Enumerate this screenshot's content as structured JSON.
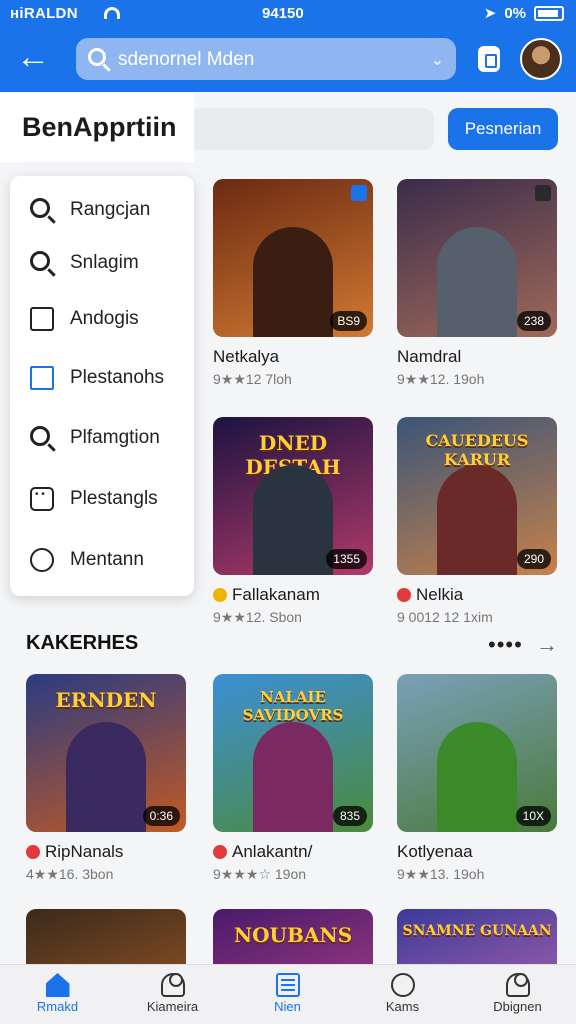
{
  "status": {
    "carrier": "ніRALDN",
    "time": "94150",
    "battery": "0%"
  },
  "header": {
    "search_text": "sdenornel Mden"
  },
  "page": {
    "title": "BenApprtiin",
    "primary_button": "Pesnerian"
  },
  "menu": {
    "items": [
      {
        "label": "Rangcjan",
        "icon": "search-icon"
      },
      {
        "label": "Snlagim",
        "icon": "search-icon"
      },
      {
        "label": "Andogis",
        "icon": "checkbox-icon"
      },
      {
        "label": "Plestanohs",
        "icon": "checkbox-outline-icon"
      },
      {
        "label": "Plfamgtion",
        "icon": "search-icon"
      },
      {
        "label": "Plestangls",
        "icon": "grid-icon"
      },
      {
        "label": "Mentann",
        "icon": "clock-icon"
      }
    ]
  },
  "featured": [
    {
      "name": "Netkalya",
      "meta": "9★★12 7loh",
      "badge": "BS9",
      "colors": [
        "#6b2a12",
        "#d27a32"
      ],
      "figure": "#3a1e14"
    },
    {
      "name": "Namdral",
      "meta": "9★★12. 19oh",
      "badge": "238",
      "colors": [
        "#3b2c4a",
        "#a06a5a"
      ],
      "figure": "#55606c"
    },
    {
      "name": "Fallakanam",
      "meta": "9★★12. Sbon",
      "badge": "1355",
      "logo": "DNED DESTAH",
      "colors": [
        "#1c1340",
        "#b23a6a"
      ],
      "figure": "#2a3340"
    },
    {
      "name": "Nelkia",
      "meta": "9 0012 12 1xim",
      "badge": "290",
      "logo": "CAUEDEUS KARUR",
      "colors": [
        "#3a5578",
        "#c7814a"
      ],
      "figure": "#6a2a2a"
    }
  ],
  "section": {
    "title": "KAKERHES"
  },
  "section_cards": [
    {
      "name": "RipNanals",
      "meta": "4★★16. 3bon",
      "badge": "0:36",
      "logo": "ERNDEN",
      "colors": [
        "#2a3b82",
        "#c35a22"
      ],
      "figure": "#3a2a60"
    },
    {
      "name": "Anlakantn/",
      "meta": "9★★★☆ 19on",
      "badge": "835",
      "logo": "NALAIE SAVIDOVRS",
      "colors": [
        "#3c8fd6",
        "#4c8a3a"
      ],
      "figure": "#7a2a60"
    },
    {
      "name": "Kotlyenaa",
      "meta": "9★★13. 19oh",
      "badge": "10X",
      "colors": [
        "#7aa0b8",
        "#4a7a3a"
      ],
      "figure": "#3b8a2a"
    }
  ],
  "bottom_row": [
    {
      "colors": [
        "#3a2a1a",
        "#b4622a"
      ]
    },
    {
      "logo": "NOUBANS",
      "colors": [
        "#4a1a6a",
        "#c04a8a"
      ]
    },
    {
      "logo": "SNAMNE GUNAAN",
      "colors": [
        "#3a3a9a",
        "#d070b0"
      ]
    }
  ],
  "nav": [
    {
      "label": "Rmakd",
      "icon": "home-icon",
      "active": true
    },
    {
      "label": "Kiameira",
      "icon": "profile-icon",
      "active": false
    },
    {
      "label": "Nien",
      "icon": "news-icon",
      "active": true
    },
    {
      "label": "Kams",
      "icon": "chat-icon",
      "active": false
    },
    {
      "label": "Dbignen",
      "icon": "person-icon",
      "active": false
    }
  ],
  "colors": {
    "accent": "#1a73e8",
    "header": "#1a73e8"
  }
}
